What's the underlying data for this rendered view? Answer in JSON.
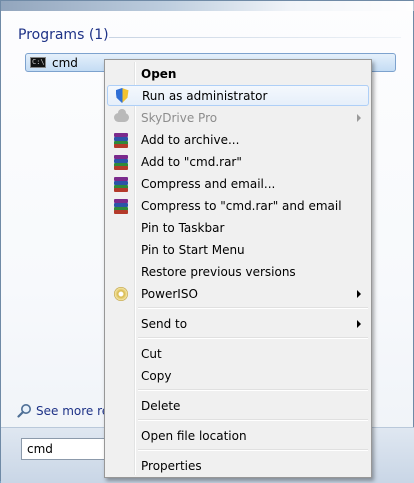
{
  "start_menu": {
    "section_header": "Programs (1)",
    "result_item": "cmd",
    "see_more": "See more resu",
    "search_value": "cmd"
  },
  "context_menu": {
    "items": [
      {
        "label": "Open",
        "icon": "none",
        "bold": true
      },
      {
        "label": "Run as administrator",
        "icon": "uac-shield-icon",
        "highlighted": true
      },
      {
        "label": "SkyDrive Pro",
        "icon": "cloud-icon",
        "disabled": true,
        "submenu": true
      },
      {
        "label": "Add to archive...",
        "icon": "winrar-icon"
      },
      {
        "label": "Add to \"cmd.rar\"",
        "icon": "winrar-icon"
      },
      {
        "label": "Compress and email...",
        "icon": "winrar-icon"
      },
      {
        "label": "Compress to \"cmd.rar\" and email",
        "icon": "winrar-icon"
      },
      {
        "label": "Pin to Taskbar",
        "icon": "none"
      },
      {
        "label": "Pin to Start Menu",
        "icon": "none"
      },
      {
        "label": "Restore previous versions",
        "icon": "none"
      },
      {
        "label": "PowerISO",
        "icon": "disc-icon",
        "submenu": true
      },
      {
        "label": "Send to",
        "icon": "none",
        "submenu": true
      },
      {
        "label": "Cut",
        "icon": "none"
      },
      {
        "label": "Copy",
        "icon": "none"
      },
      {
        "label": "Delete",
        "icon": "none"
      },
      {
        "label": "Open file location",
        "icon": "none"
      },
      {
        "label": "Properties",
        "icon": "none"
      }
    ]
  },
  "colors": {
    "header_text": "#1e3287",
    "highlight_border": "#aecff7",
    "menu_background": "#f0f0f0"
  }
}
